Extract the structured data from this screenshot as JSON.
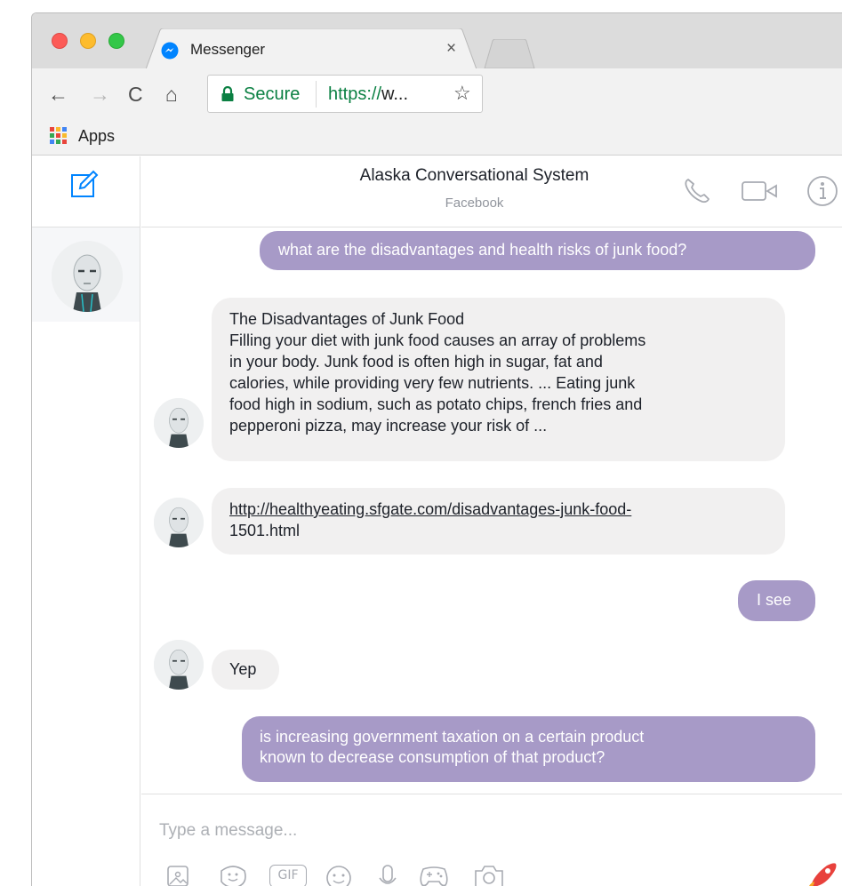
{
  "browser": {
    "tab_title": "Messenger",
    "tab_close": "×",
    "secure_label": "Secure",
    "url_scheme": "https://",
    "url_rest": "w...",
    "bookmark_apps": "Apps",
    "nav": {
      "back": "←",
      "forward": "→",
      "reload": "C",
      "home": "⌂",
      "star": "☆"
    }
  },
  "conversation": {
    "title": "Alaska Conversational System",
    "subtitle": "Facebook"
  },
  "messages": {
    "m1": "what are the disadvantages and health risks of junk food?",
    "m2_lines": [
      "The Disadvantages of Junk Food",
      "Filling your diet with junk food causes an array of problems",
      "in your body. Junk food is often high in sugar, fat and",
      "calories, while providing very few nutrients. ... Eating junk",
      "food high in sodium, such as potato chips, french fries and",
      "pepperoni pizza, may increase your risk of ..."
    ],
    "m3_link_line1": "http://healthyeating.sfgate.com/disadvantages-junk-food-",
    "m3_link_line2": "1501.html",
    "m4": "I see",
    "m5": "Yep",
    "m6_line1": "is increasing government taxation on a certain product",
    "m6_line2": "known to decrease consumption of that product?"
  },
  "composer": {
    "placeholder": "Type a message...",
    "gif_label": "GIF"
  },
  "colors": {
    "outgoing_bubble": "#a79ac7",
    "incoming_bubble": "#f1f0f0",
    "messenger_blue": "#0084ff",
    "secure_green": "#0b8043"
  }
}
